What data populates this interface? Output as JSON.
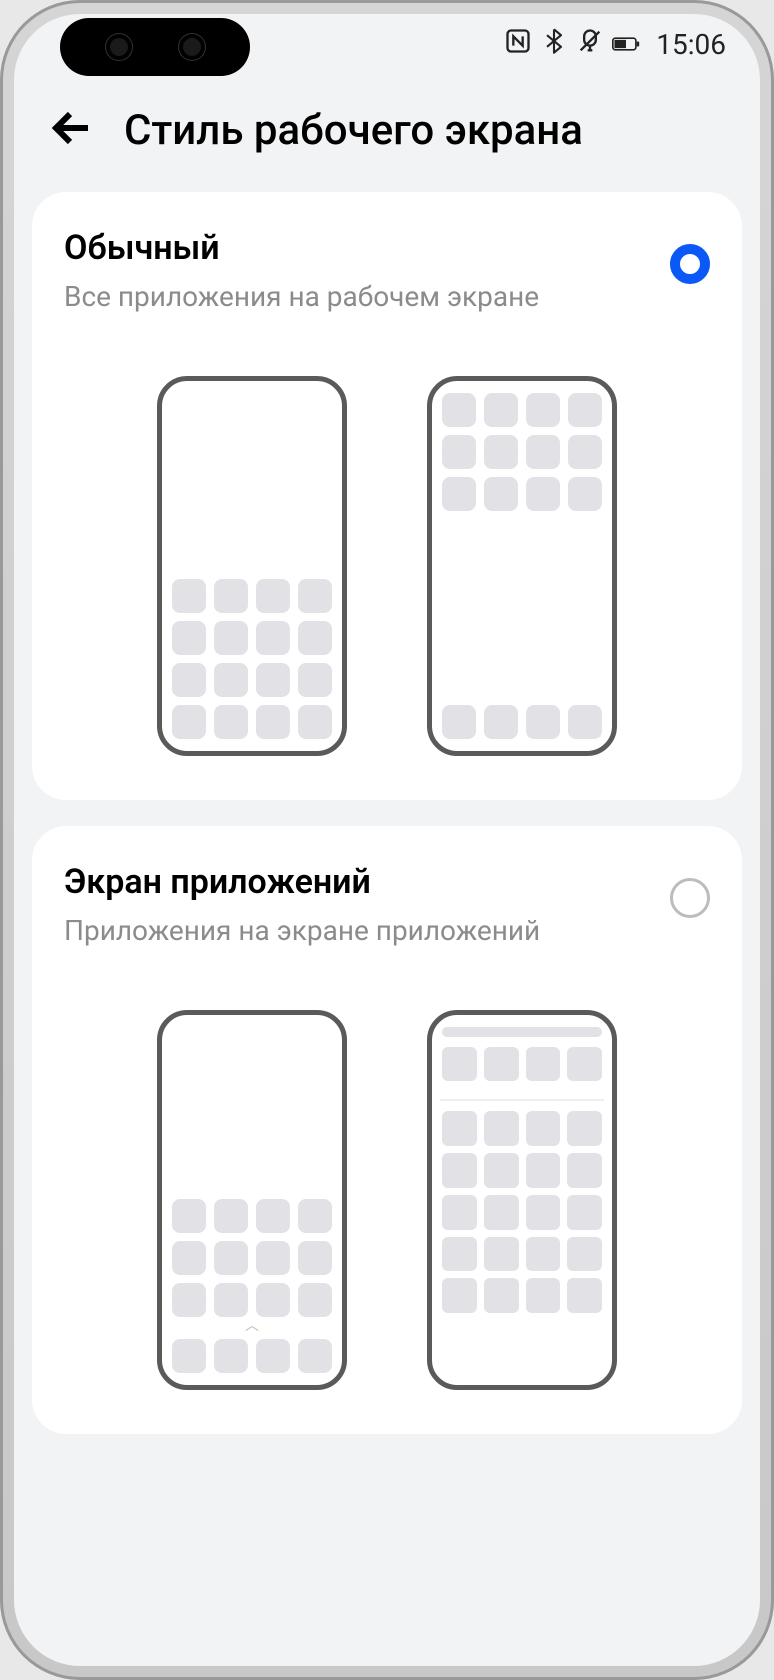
{
  "status": {
    "time": "15:06"
  },
  "header": {
    "title": "Стиль рабочего экрана"
  },
  "options": {
    "standard": {
      "title": "Обычный",
      "subtitle": "Все приложения на рабочем экране",
      "selected": true
    },
    "drawer": {
      "title": "Экран приложений",
      "subtitle": "Приложения на экране приложений",
      "selected": false
    }
  }
}
